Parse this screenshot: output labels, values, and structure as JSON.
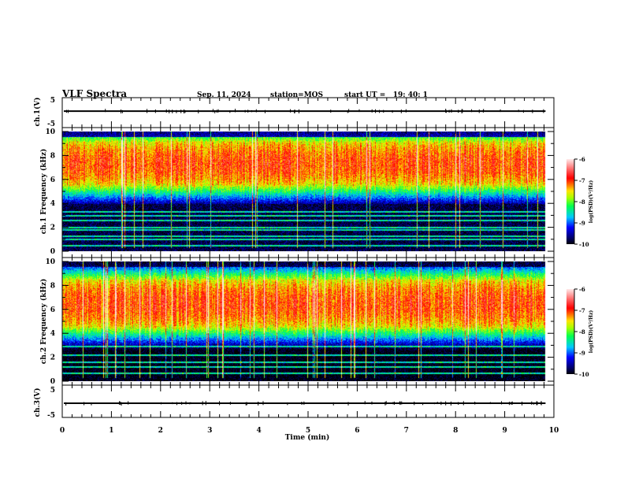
{
  "header": {
    "title": "VLF Spectra",
    "date": "Sep. 11, 2024",
    "station": "station=MOS",
    "start": "start UT =   19: 40: 1"
  },
  "chart_data": [
    {
      "type": "line",
      "name_label": "ch.1(V)",
      "ylim": [
        -5,
        5
      ],
      "yticks": [
        "5",
        "-5"
      ],
      "xlim": [
        0,
        10
      ],
      "data_end_min": 9.83,
      "level": 0.3
    },
    {
      "type": "heatmap",
      "ylabel": "ch.1  Frequency (kHz)",
      "ylim": [
        0,
        10
      ],
      "yticks": [
        "0",
        "2",
        "4",
        "6",
        "8",
        "10"
      ],
      "xlim": [
        0,
        10
      ],
      "data_end_min": 9.83,
      "peak_band_khz": [
        5.5,
        9.2
      ],
      "colorbar": {
        "label": "log(PSD)(V²/Hz)",
        "range": [
          -10,
          -6
        ],
        "ticks": [
          "-6",
          "-7",
          "-8",
          "-9",
          "-10"
        ]
      }
    },
    {
      "type": "heatmap",
      "ylabel": "ch.2  Frequency (kHz)",
      "ylim": [
        0,
        10
      ],
      "yticks": [
        "0",
        "2",
        "4",
        "6",
        "8",
        "10"
      ],
      "xlim": [
        0,
        10
      ],
      "data_end_min": 9.83,
      "peak_band_khz": [
        4.5,
        8.5
      ],
      "colorbar": {
        "label": "log(PSD)(V²/Hz)",
        "range": [
          -10,
          -6
        ],
        "ticks": [
          "-6",
          "-7",
          "-8",
          "-9",
          "-10"
        ]
      }
    },
    {
      "type": "line",
      "name_label": "ch.3(V)",
      "ylim": [
        -5,
        5
      ],
      "yticks": [
        "5",
        "-5"
      ],
      "xlim": [
        0,
        10
      ],
      "data_end_min": 9.83,
      "level": -0.3
    }
  ],
  "xaxis": {
    "label": "Time  (min)",
    "ticks": [
      "0",
      "1",
      "2",
      "3",
      "4",
      "5",
      "6",
      "7",
      "8",
      "9",
      "10"
    ]
  },
  "colors": {
    "line": "#000000",
    "background": "#ffffff"
  }
}
